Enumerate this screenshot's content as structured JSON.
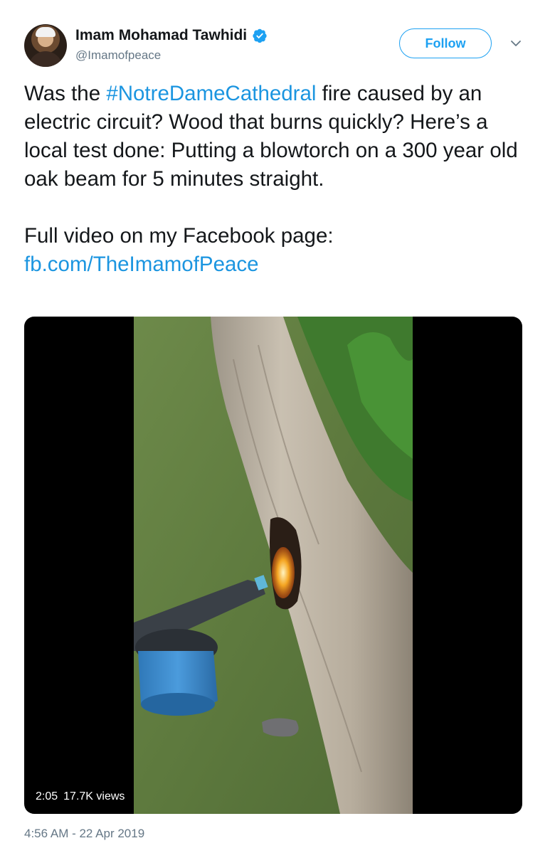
{
  "author": {
    "name": "Imam Mohamad Tawhidi",
    "handle": "@Imamofpeace",
    "verified": true
  },
  "follow_button": {
    "label": "Follow"
  },
  "tweet": {
    "text_before_hashtag": "Was the ",
    "hashtag": "#NotreDameCathedral",
    "text_after_hashtag": " fire caused by an electric circuit? Wood that burns quickly? Here’s a local test done: Putting a blowtorch on a 300 year old oak beam for 5 minutes straight.",
    "paragraph2_text": "Full video on my Facebook page:",
    "paragraph2_link": "fb.com/TheImamofPeace"
  },
  "media": {
    "duration": "2:05",
    "views": "17.7K views"
  },
  "timestamp": "4:56 AM - 22 Apr 2019",
  "colors": {
    "link": "#1b95e0",
    "follow_accent": "#1da1f2",
    "muted": "#657786",
    "text": "#14171a"
  },
  "icons": {
    "verified": "verified-badge-icon",
    "more": "chevron-down-icon"
  }
}
